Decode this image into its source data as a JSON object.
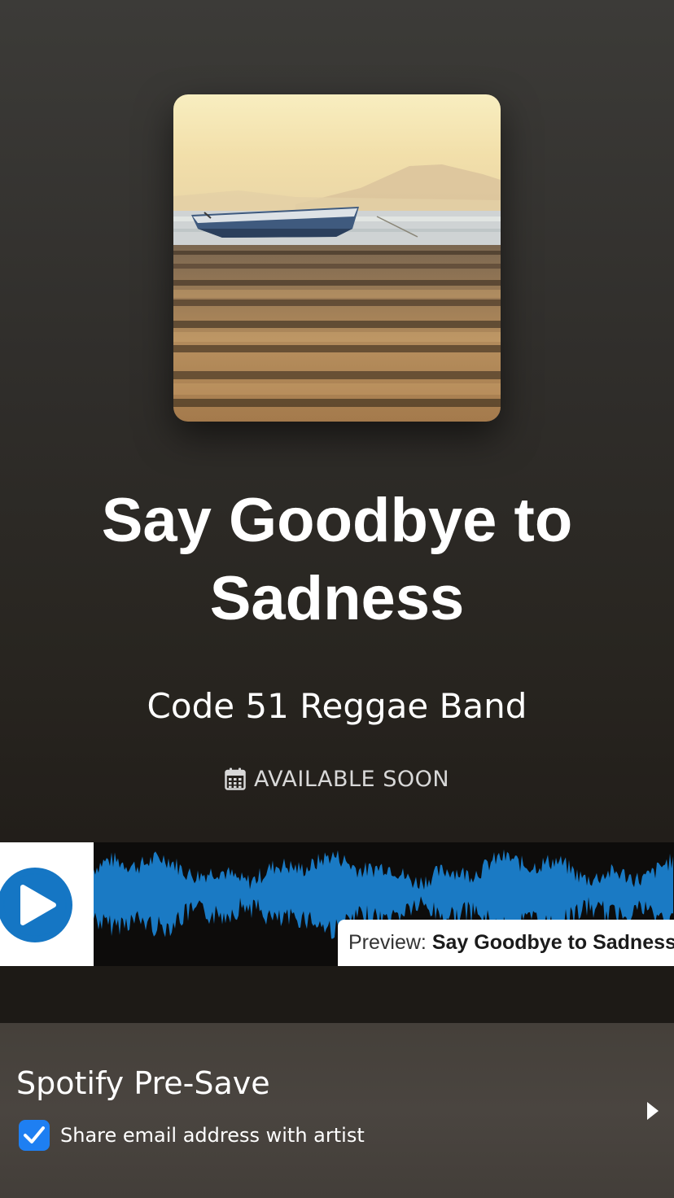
{
  "release": {
    "title": "Say Goodbye to Sadness",
    "artist": "Code 51 Reggae Band",
    "status": "AVAILABLE SOON",
    "status_icon": "calendar-icon"
  },
  "player": {
    "play_icon": "play-icon",
    "preview_prefix": "Preview:",
    "preview_track": "Say Goodbye to Sadness",
    "waveform_color": "#1a7ac4"
  },
  "presave": {
    "title": "Spotify Pre-Save",
    "share_label": "Share email address with artist",
    "share_checked": true,
    "checkbox_color": "#1e7ff2",
    "arrow_icon": "chevron-right-icon"
  }
}
